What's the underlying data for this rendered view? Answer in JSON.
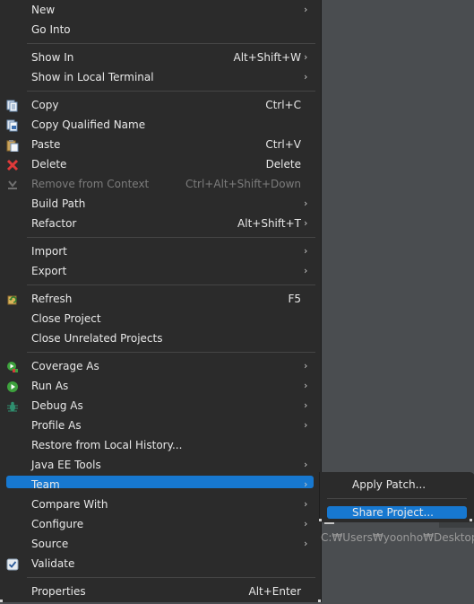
{
  "menu": {
    "new": {
      "label": "New"
    },
    "go_into": {
      "label": "Go Into"
    },
    "show_in": {
      "label": "Show In",
      "shortcut": "Alt+Shift+W"
    },
    "show_in_terminal": {
      "label": "Show in Local Terminal"
    },
    "copy": {
      "label": "Copy",
      "shortcut": "Ctrl+C",
      "icon": "copy-icon"
    },
    "copy_qualified": {
      "label": "Copy Qualified Name",
      "icon": "copy-qualified-icon"
    },
    "paste": {
      "label": "Paste",
      "shortcut": "Ctrl+V",
      "icon": "paste-icon"
    },
    "delete": {
      "label": "Delete",
      "shortcut": "Delete",
      "icon": "delete-icon"
    },
    "remove_context": {
      "label": "Remove from Context",
      "shortcut": "Ctrl+Alt+Shift+Down",
      "icon": "remove-context-icon"
    },
    "build_path": {
      "label": "Build Path"
    },
    "refactor": {
      "label": "Refactor",
      "shortcut": "Alt+Shift+T"
    },
    "import": {
      "label": "Import"
    },
    "export": {
      "label": "Export"
    },
    "refresh": {
      "label": "Refresh",
      "shortcut": "F5",
      "icon": "refresh-icon"
    },
    "close_project": {
      "label": "Close Project"
    },
    "close_unrelated": {
      "label": "Close Unrelated Projects"
    },
    "coverage_as": {
      "label": "Coverage As",
      "icon": "coverage-icon"
    },
    "run_as": {
      "label": "Run As",
      "icon": "run-icon"
    },
    "debug_as": {
      "label": "Debug As",
      "icon": "debug-bug-icon"
    },
    "profile_as": {
      "label": "Profile As"
    },
    "restore_history": {
      "label": "Restore from Local History..."
    },
    "java_ee_tools": {
      "label": "Java EE Tools"
    },
    "team": {
      "label": "Team"
    },
    "compare_with": {
      "label": "Compare With"
    },
    "configure": {
      "label": "Configure"
    },
    "source": {
      "label": "Source"
    },
    "validate": {
      "label": "Validate",
      "icon": "checkbox-checked-icon"
    },
    "properties": {
      "label": "Properties",
      "shortcut": "Alt+Enter"
    }
  },
  "submenu": {
    "apply_patch": {
      "label": "Apply Patch..."
    },
    "share_project": {
      "label": "Share Project..."
    }
  },
  "background": {
    "path_text": "C:₩Users₩yoonho₩Desktop₩비"
  },
  "colors": {
    "menu_bg": "#2b2b2b",
    "selection": "#1778d0",
    "separator": "#454545",
    "disabled_text": "#7c7c7c",
    "workspace_bg": "#4a4d50"
  }
}
